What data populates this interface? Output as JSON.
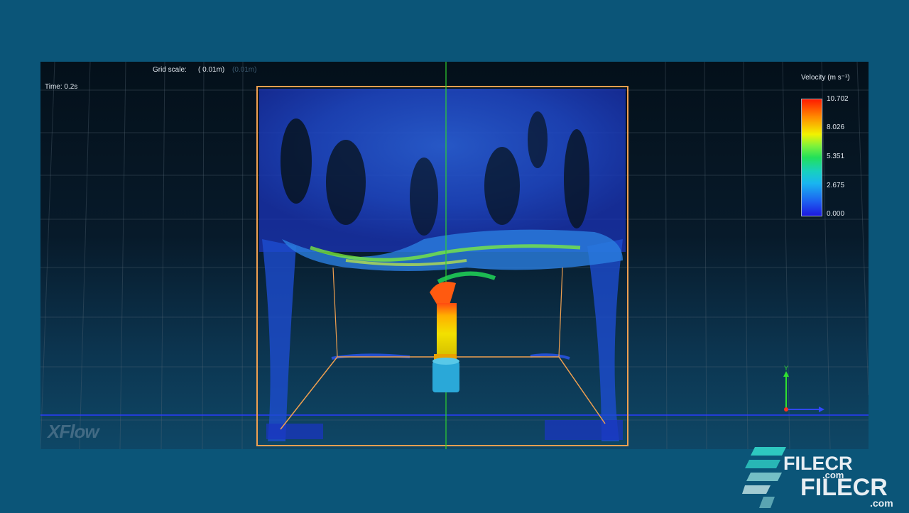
{
  "hud": {
    "time": "Time: 0.2s",
    "grid_scale_label": "Grid scale:",
    "grid_scale_value": "( 0.01m)",
    "grid_scale_ghost": "(0.01m)"
  },
  "legend": {
    "title": "Velocity (m s⁻¹)",
    "max": "10.702",
    "tick_1": "8.026",
    "tick_2": "5.351",
    "tick_3": "2.675",
    "min": "0.000",
    "gradient_colors": [
      "#ff1a00",
      "#ff8a00",
      "#f2f200",
      "#22e05a",
      "#19b6f0",
      "#1d18e0"
    ]
  },
  "axes": {
    "y_label": "Y"
  },
  "logo": {
    "text": "XFlow"
  },
  "watermark": {
    "line1": "FILECR",
    "line1_suffix": ".com",
    "line2": "FILECR",
    "line2_suffix": ".com"
  },
  "colors": {
    "background": "#0b5578",
    "box_edge": "#f0a050",
    "center_axis": "#2fd02f",
    "ground_line": "#2a3cff"
  }
}
